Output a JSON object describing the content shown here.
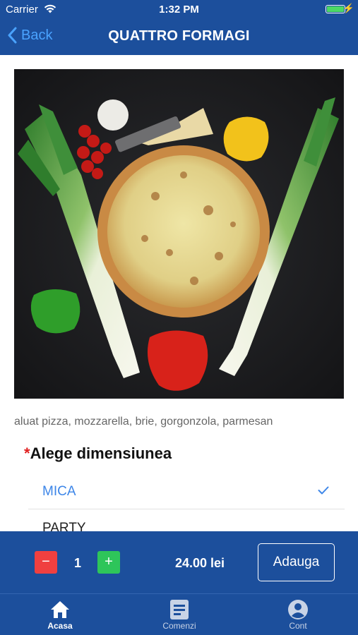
{
  "status_bar": {
    "carrier": "Carrier",
    "time": "1:32 PM"
  },
  "nav": {
    "back_label": "Back",
    "title": "QUATTRO FORMAGI"
  },
  "product": {
    "ingredients": "aluat pizza, mozzarella, brie, gorgonzola, parmesan"
  },
  "size_section": {
    "required_marker": "*",
    "title": "Alege dimensiunea",
    "options": [
      {
        "label": "MICA",
        "selected": true
      },
      {
        "label": "PARTY",
        "selected": false
      }
    ]
  },
  "order": {
    "minus": "−",
    "quantity": "1",
    "plus": "+",
    "price": "24.00 lei",
    "add_label": "Adauga"
  },
  "tabs": [
    {
      "label": "Acasa",
      "active": true,
      "icon": "home-icon"
    },
    {
      "label": "Comenzi",
      "active": false,
      "icon": "list-icon"
    },
    {
      "label": "Cont",
      "active": false,
      "icon": "account-icon"
    }
  ],
  "colors": {
    "brand_blue": "#1c4f9c",
    "link_blue": "#3d86e8",
    "minus_red": "#f04040",
    "plus_green": "#2ec55a",
    "required_red": "#e02020"
  }
}
